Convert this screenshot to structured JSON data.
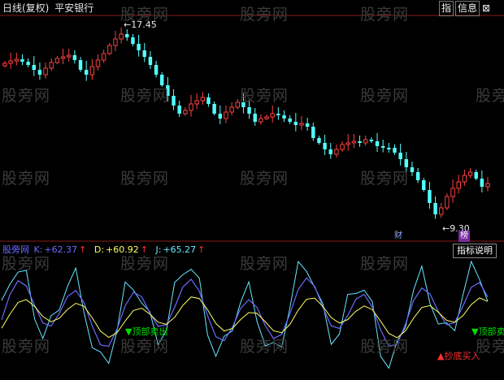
{
  "header": {
    "title": "日线(复权)",
    "stock": "平安银行"
  },
  "toolbar": {
    "btn1": "指",
    "btn2": "信息",
    "close": "■"
  },
  "watermark": "股旁网",
  "price": {
    "high_label": "17.45",
    "low_label": "9.30",
    "up_color": "#ff4040",
    "down_color": "#54ffff"
  },
  "badges": {
    "fin": "财",
    "list": "榜"
  },
  "indicator": {
    "name": "股旁网",
    "k_label": "K:",
    "k_value": "+62.37",
    "d_label": "D:",
    "d_value": "+60.92",
    "j_label": "J:",
    "j_value": "+65.27",
    "help": "指标说明",
    "sell1": "顶部卖出",
    "sell2": "顶部卖",
    "buy": "抄底买入"
  },
  "colors": {
    "k": "#6a6aff",
    "d": "#ffff60",
    "j": "#66e8ff",
    "sell": "#00e000",
    "buy": "#ff3030",
    "divider": "#8b1a1a"
  }
}
